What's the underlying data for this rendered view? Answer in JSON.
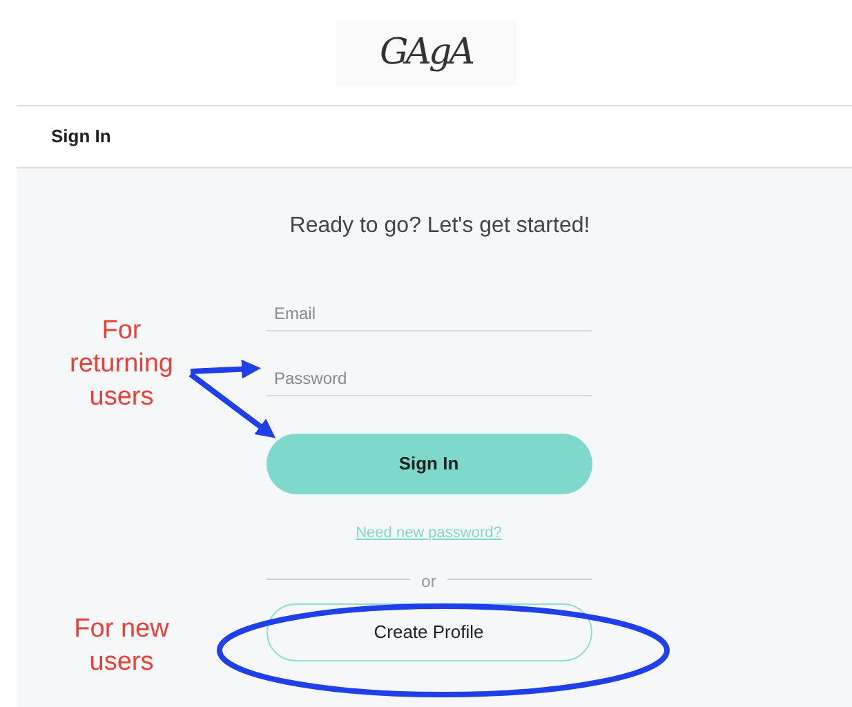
{
  "logo": "GAgA",
  "nav": {
    "title": "Sign In"
  },
  "form": {
    "heading": "Ready to go? Let's get started!",
    "fields": [
      {
        "placeholder": "Email"
      },
      {
        "placeholder": "Password"
      }
    ],
    "sign_in_button": "Sign In",
    "forgot_link": "Need new password?",
    "separator": "or",
    "create_button": "Create Profile"
  },
  "annotations": [
    {
      "text": "For returning users"
    },
    {
      "text": "For new users"
    }
  ]
}
